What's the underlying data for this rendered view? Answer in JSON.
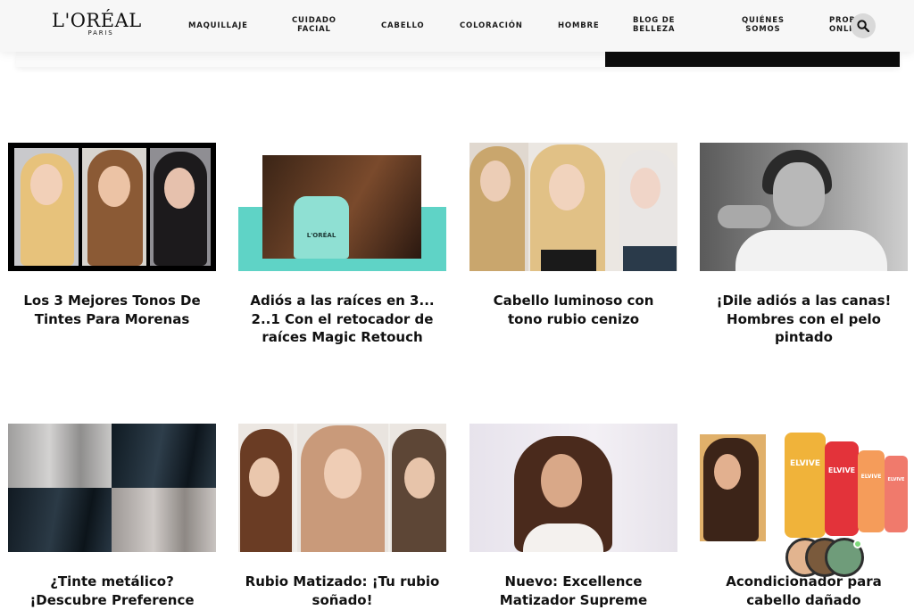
{
  "header": {
    "logo": {
      "brand": "L'ORÉAL",
      "city": "PARIS"
    },
    "nav": [
      {
        "lines": [
          "MAQUILLAJE"
        ]
      },
      {
        "lines": [
          "CUIDADO",
          "FACIAL"
        ]
      },
      {
        "lines": [
          "CABELLO"
        ]
      },
      {
        "lines": [
          "COLORACIÓN"
        ]
      },
      {
        "lines": [
          "HOMBRE"
        ]
      },
      {
        "lines": [
          "BLOG DE",
          "BELLEZA"
        ]
      },
      {
        "lines": [
          "QUIÉNES",
          "SOMOS"
        ]
      },
      {
        "lines": [
          "PROB",
          "ONLI"
        ]
      }
    ],
    "search_icon": "search-icon"
  },
  "articles": [
    {
      "title": "Los 3 Mejores Tonos De Tintes Para Morenas"
    },
    {
      "title": "Adiós a las raíces en 3... 2..1 Con el retocador de raíces Magic Retouch"
    },
    {
      "title": "Cabello luminoso con tono rubio cenizo"
    },
    {
      "title": "¡Dile adiós a las canas! Hombres con el pelo pintado"
    },
    {
      "title": "¿Tinte metálico? ¡Descubre Preference"
    },
    {
      "title": "Rubio Matizado: ¡Tu rubio soñado!"
    },
    {
      "title": "Nuevo: Excellence Matizador Supreme"
    },
    {
      "title": "Acondicionador para cabello dañado"
    }
  ],
  "product_labels": [
    "ELVIVE",
    "ELVIVE",
    "ELVIVE",
    "ELVIVE"
  ],
  "spray_brand": "L'ORÉAL",
  "colors": {
    "header_bg": "#f7f7f7",
    "teal": "#5fd3c6",
    "text": "#111111",
    "online": "#7dd87a"
  }
}
